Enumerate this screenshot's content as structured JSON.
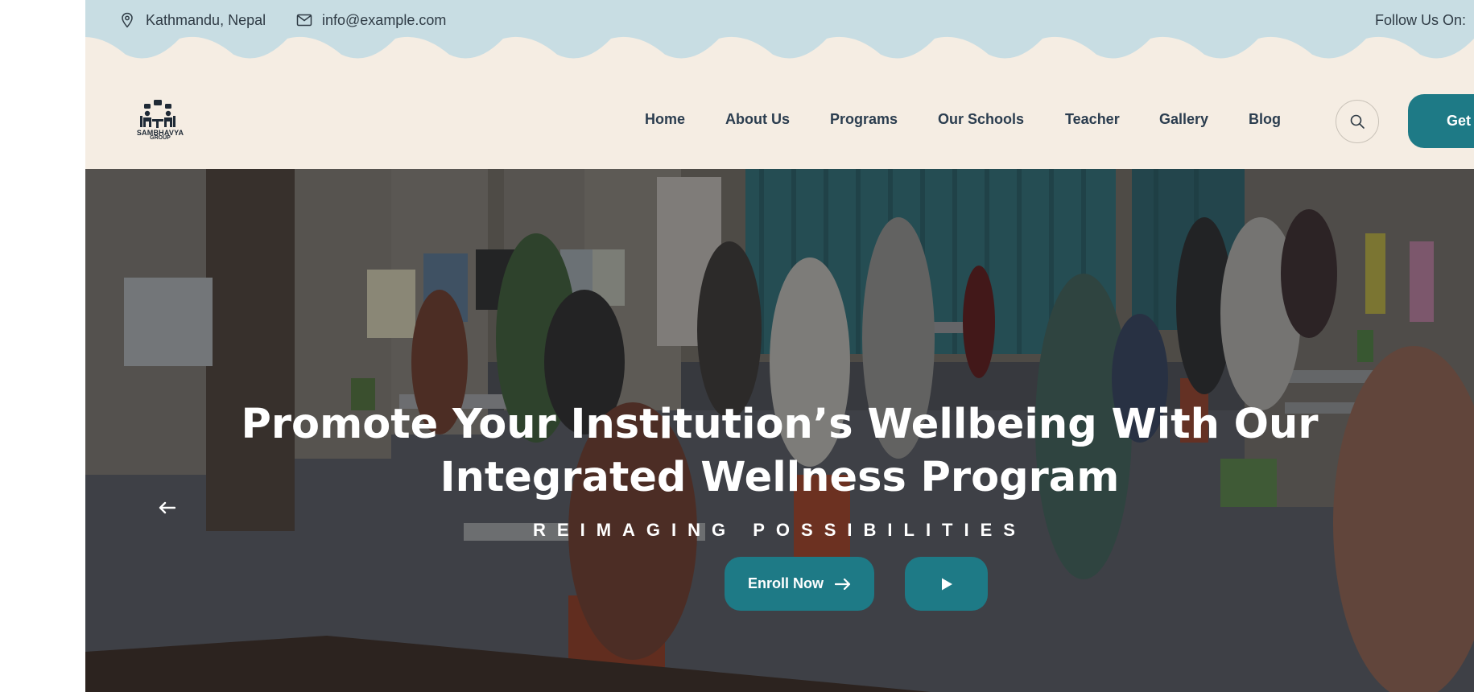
{
  "topbar": {
    "location": "Kathmandu, Nepal",
    "email": "info@example.com",
    "follow_label": "Follow Us On:",
    "location_icon": "map-pin-icon",
    "email_icon": "envelope-icon"
  },
  "logo": {
    "line1": "SAMBHAVYA",
    "line2": "GROUP"
  },
  "nav": {
    "items": [
      {
        "label": "Home"
      },
      {
        "label": "About Us"
      },
      {
        "label": "Programs"
      },
      {
        "label": "Our Schools"
      },
      {
        "label": "Teacher"
      },
      {
        "label": "Gallery"
      },
      {
        "label": "Blog"
      }
    ],
    "search_icon": "search-icon",
    "cta_label": "Get A"
  },
  "hero": {
    "title_line1": "Promote Your Institution’s Wellbeing With Our",
    "title_line2": "Integrated Wellness Program",
    "subtitle": "REIMAGING POSSIBILITIES",
    "enroll_label": "Enroll Now",
    "enroll_icon": "arrow-right-icon",
    "play_icon": "play-icon",
    "prev_icon": "arrow-left-icon"
  },
  "colors": {
    "topbar_bg": "#c8dde3",
    "header_bg": "#f5ede3",
    "accent": "#1e7a86",
    "nav_text": "#2b3d4f"
  }
}
